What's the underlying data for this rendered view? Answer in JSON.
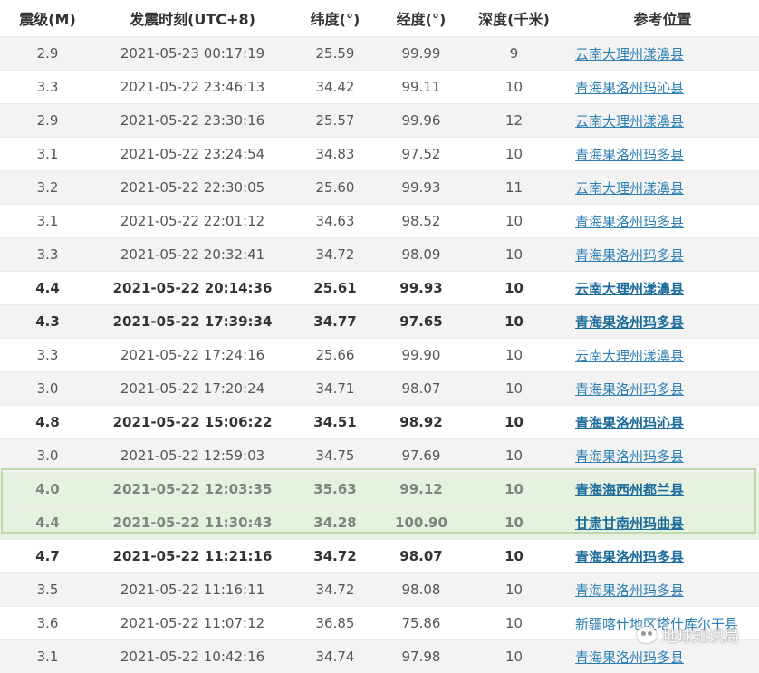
{
  "headers": {
    "mag": "震级(M)",
    "time": "发震时刻(UTC+8)",
    "lat": "纬度(°)",
    "lon": "经度(°)",
    "depth": "深度(千米)",
    "loc": "参考位置"
  },
  "rows": [
    {
      "mag": "2.9",
      "time": "2021-05-23 00:17:19",
      "lat": "25.59",
      "lon": "99.99",
      "depth": "9",
      "loc": "云南大理州漾濞县",
      "style": "alt"
    },
    {
      "mag": "3.3",
      "time": "2021-05-22 23:46:13",
      "lat": "34.42",
      "lon": "99.11",
      "depth": "10",
      "loc": "青海果洛州玛沁县",
      "style": ""
    },
    {
      "mag": "2.9",
      "time": "2021-05-22 23:30:16",
      "lat": "25.57",
      "lon": "99.96",
      "depth": "12",
      "loc": "云南大理州漾濞县",
      "style": "alt"
    },
    {
      "mag": "3.1",
      "time": "2021-05-22 23:24:54",
      "lat": "34.83",
      "lon": "97.52",
      "depth": "10",
      "loc": "青海果洛州玛多县",
      "style": ""
    },
    {
      "mag": "3.2",
      "time": "2021-05-22 22:30:05",
      "lat": "25.60",
      "lon": "99.93",
      "depth": "11",
      "loc": "云南大理州漾濞县",
      "style": "alt"
    },
    {
      "mag": "3.1",
      "time": "2021-05-22 22:01:12",
      "lat": "34.63",
      "lon": "98.52",
      "depth": "10",
      "loc": "青海果洛州玛多县",
      "style": ""
    },
    {
      "mag": "3.3",
      "time": "2021-05-22 20:32:41",
      "lat": "34.72",
      "lon": "98.09",
      "depth": "10",
      "loc": "青海果洛州玛多县",
      "style": "alt"
    },
    {
      "mag": "4.4",
      "time": "2021-05-22 20:14:36",
      "lat": "25.61",
      "lon": "99.93",
      "depth": "10",
      "loc": "云南大理州漾濞县",
      "style": "bold"
    },
    {
      "mag": "4.3",
      "time": "2021-05-22 17:39:34",
      "lat": "34.77",
      "lon": "97.65",
      "depth": "10",
      "loc": "青海果洛州玛多县",
      "style": "alt bold"
    },
    {
      "mag": "3.3",
      "time": "2021-05-22 17:24:16",
      "lat": "25.66",
      "lon": "99.90",
      "depth": "10",
      "loc": "云南大理州漾濞县",
      "style": ""
    },
    {
      "mag": "3.0",
      "time": "2021-05-22 17:20:24",
      "lat": "34.71",
      "lon": "98.07",
      "depth": "10",
      "loc": "青海果洛州玛多县",
      "style": "alt"
    },
    {
      "mag": "4.8",
      "time": "2021-05-22 15:06:22",
      "lat": "34.51",
      "lon": "98.92",
      "depth": "10",
      "loc": "青海果洛州玛沁县",
      "style": "bold"
    },
    {
      "mag": "3.0",
      "time": "2021-05-22 12:59:03",
      "lat": "34.75",
      "lon": "97.69",
      "depth": "10",
      "loc": "青海果洛州玛多县",
      "style": "alt"
    },
    {
      "mag": "4.0",
      "time": "2021-05-22 12:03:35",
      "lat": "35.63",
      "lon": "99.12",
      "depth": "10",
      "loc": "青海海西州都兰县",
      "style": "hl bold"
    },
    {
      "mag": "4.4",
      "time": "2021-05-22 11:30:43",
      "lat": "34.28",
      "lon": "100.90",
      "depth": "10",
      "loc": "甘肃甘南州玛曲县",
      "style": "hl bold"
    },
    {
      "mag": "4.7",
      "time": "2021-05-22 11:21:16",
      "lat": "34.72",
      "lon": "98.07",
      "depth": "10",
      "loc": "青海果洛州玛多县",
      "style": "bold"
    },
    {
      "mag": "3.5",
      "time": "2021-05-22 11:16:11",
      "lat": "34.72",
      "lon": "98.08",
      "depth": "10",
      "loc": "青海果洛州玛多县",
      "style": "alt"
    },
    {
      "mag": "3.6",
      "time": "2021-05-22 11:07:12",
      "lat": "36.85",
      "lon": "75.86",
      "depth": "10",
      "loc": "新疆喀什地区塔什库尔干县",
      "style": ""
    },
    {
      "mag": "3.1",
      "time": "2021-05-22 10:42:16",
      "lat": "34.74",
      "lon": "97.98",
      "depth": "10",
      "loc": "青海果洛州玛多县",
      "style": "alt"
    }
  ],
  "watermark": {
    "icon": "wechat-icon",
    "text": "地球知识局"
  }
}
